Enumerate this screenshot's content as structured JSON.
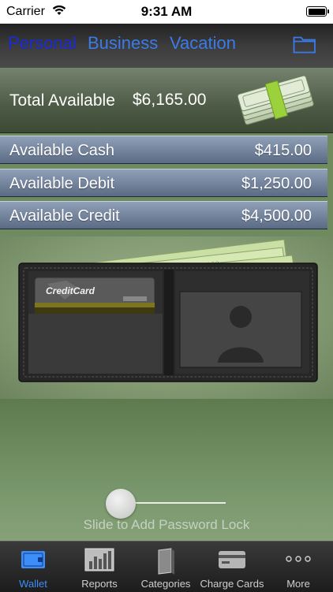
{
  "status_bar": {
    "carrier": "Carrier",
    "time": "9:31 AM",
    "wifi_icon": "wifi-icon",
    "battery_icon": "battery-icon"
  },
  "top_tabs": [
    {
      "label": "Personal",
      "active": true
    },
    {
      "label": "Business",
      "active": false
    },
    {
      "label": "Vacation",
      "active": false
    }
  ],
  "total": {
    "label": "Total Available",
    "value": "$6,165.00"
  },
  "available": [
    {
      "label": "Available Cash",
      "value": "$415.00"
    },
    {
      "label": "Available Debit",
      "value": "$1,250.00"
    },
    {
      "label": "Available Credit",
      "value": "$4,500.00"
    }
  ],
  "wallet": {
    "card_text": "CreditCard"
  },
  "slider": {
    "label": "Slide to Add Password Lock",
    "value": 0
  },
  "tab_bar": [
    {
      "label": "Wallet",
      "icon": "wallet-icon",
      "active": true
    },
    {
      "label": "Reports",
      "icon": "bar-chart-icon",
      "active": false
    },
    {
      "label": "Categories",
      "icon": "book-icon",
      "active": false
    },
    {
      "label": "Charge Cards",
      "icon": "credit-card-icon",
      "active": false
    },
    {
      "label": "More",
      "icon": "more-icon",
      "active": false
    }
  ],
  "colors": {
    "accent": "#3d8ef8",
    "active_top_tab": "#1a2ad6",
    "top_tab": "#3b7be9",
    "background": "#6f8a5f"
  }
}
